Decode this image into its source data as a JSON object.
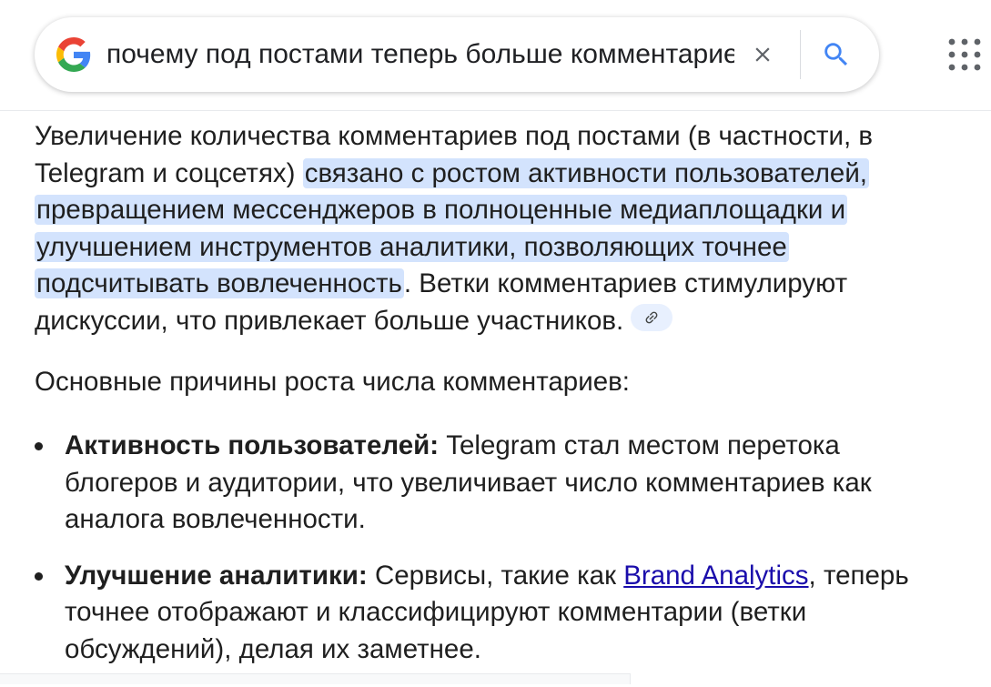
{
  "search": {
    "query": "почему под постами теперь больше комментариев",
    "placeholder": ""
  },
  "answer": {
    "p1_pre": "Увеличение количества комментариев под постами (в частности, в",
    "p1_line2_pre": "Telegram и соцсетях) ",
    "hl1": "связано с ростом активности пользователей,",
    "hl2": "превращением мессенджеров в полноценные медиаплощадки и",
    "hl3": "улучшением инструментов аналитики, позволяющих точнее",
    "hl4": "подсчитывать вовлеченность",
    "p1_line5_post": ". Ветки комментариев стимулируют",
    "p1_line6": "дискуссии, что привлекает больше участников.",
    "intro": "Основные причины роста числа комментариев:",
    "bullets": [
      {
        "title": "Активность пользователей:",
        "line1": " Telegram стал местом перетока",
        "line2": "блогеров и аудитории, что увеличивает число комментариев как",
        "line3": "аналога вовлеченности."
      },
      {
        "title": "Улучшение аналитики:",
        "line1_pre": " Сервисы, такие как ",
        "link": "Brand Analytics",
        "line1_post": ", теперь",
        "line2": "точнее отображают и классифицируют комментарии (ветки",
        "line3": "обсуждений), делая их заметнее."
      }
    ]
  },
  "icons": {
    "logo": "google-g-icon",
    "clear": "close-icon",
    "search": "search-icon",
    "apps": "apps-grid-icon",
    "link": "link-icon"
  },
  "colors": {
    "highlight": "#d3e3fd",
    "link": "#1a0dab",
    "text": "#1f1f1f"
  }
}
